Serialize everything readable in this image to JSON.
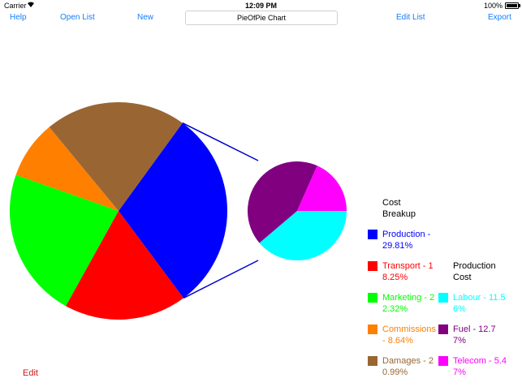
{
  "status_bar": {
    "carrier": "Carrier",
    "time": "12:09 PM",
    "battery": "100%"
  },
  "toolbar": {
    "help": "Help",
    "open_list": "Open List",
    "new": "New",
    "title": "PieOfPie Chart",
    "edit_list": "Edit List",
    "export": "Export"
  },
  "chart_data": {
    "type": "pie",
    "title": "PieOfPie Chart",
    "main": {
      "heading": "Cost Breakup",
      "slices": [
        {
          "label": "Production - 29.81%",
          "value": 29.81,
          "color": "#0000ff",
          "exploded": true
        },
        {
          "label": "Transport - 18.25%",
          "value": 18.25,
          "color": "#ff0000"
        },
        {
          "label": "Marketing - 22.32%",
          "value": 22.32,
          "color": "#00ff00"
        },
        {
          "label": "Commissions - 8.64%",
          "value": 8.64,
          "color": "#ff8000"
        },
        {
          "label": "Damages - 20.99%",
          "value": 20.99,
          "color": "#996633"
        }
      ]
    },
    "secondary": {
      "heading": "Production Cost",
      "slices": [
        {
          "label": "Labour - 11.56%",
          "value": 11.56,
          "color": "#00ffff"
        },
        {
          "label": "Fuel - 12.77%",
          "value": 12.77,
          "color": "#800080"
        },
        {
          "label": "Telecom - 5.47%",
          "value": 5.47,
          "color": "#ff00ff"
        }
      ]
    },
    "connector_color": "#0000cc",
    "legend": "right"
  },
  "footer": {
    "edit": "Edit"
  }
}
